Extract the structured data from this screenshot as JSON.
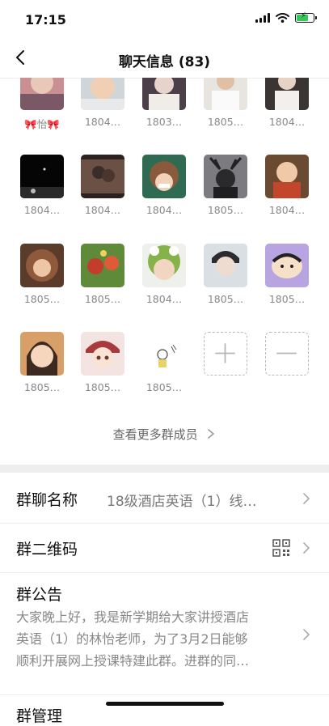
{
  "status_bar": {
    "time": "17:15",
    "battery_level": 0.75,
    "battery_color": "#35c759"
  },
  "nav": {
    "title": "聊天信息 (83)",
    "back_icon": "chevron-left-icon"
  },
  "members": [
    {
      "name": "🎀怡🎀"
    },
    {
      "name": "1804…"
    },
    {
      "name": "1803…"
    },
    {
      "name": "1805…"
    },
    {
      "name": "1804…"
    },
    {
      "name": "1804…"
    },
    {
      "name": "1804…"
    },
    {
      "name": "1804…"
    },
    {
      "name": "1805…"
    },
    {
      "name": "1804…"
    },
    {
      "name": "1805…"
    },
    {
      "name": "1805…"
    },
    {
      "name": "1804…"
    },
    {
      "name": "1805…"
    },
    {
      "name": "1805…"
    },
    {
      "name": "1805…"
    },
    {
      "name": "1805…"
    },
    {
      "name": "1805…"
    }
  ],
  "grid_actions": {
    "add_icon": "plus-icon",
    "remove_icon": "minus-icon"
  },
  "more_members": "查看更多群成员",
  "settings": {
    "group_name": {
      "label": "群聊名称",
      "value": "18级酒店英语（1）线…"
    },
    "qr_code": {
      "label": "群二维码",
      "icon": "qr-code-icon"
    },
    "notice": {
      "label": "群公告",
      "line1": "大家晚上好，我是新学期给大家讲授酒店",
      "line2": "英语（1）的林怡老师，为了3月2日能够",
      "line3": "顺利开展网上授课特建此群。进群的同…"
    },
    "next_row_label": "群管理"
  }
}
